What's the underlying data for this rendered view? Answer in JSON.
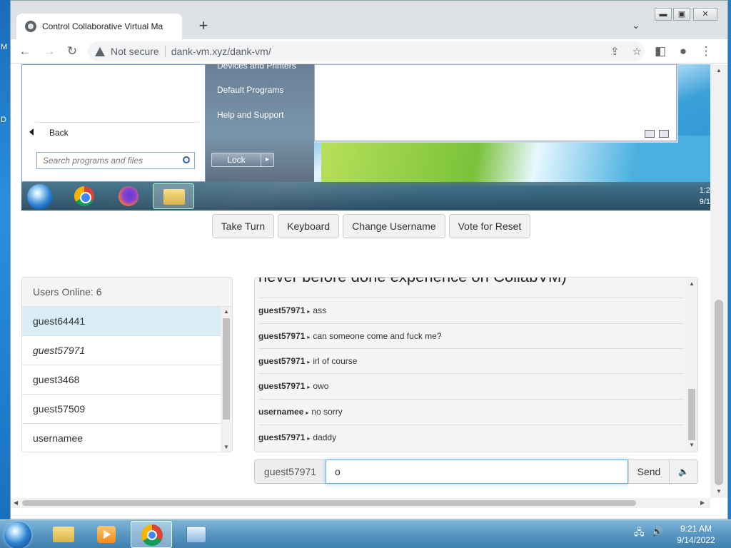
{
  "desktop": {
    "left_letters": [
      "M",
      "D"
    ]
  },
  "browser": {
    "tab_title": "Control Collaborative Virtual Ma",
    "new_tab": "+",
    "omnibox": {
      "security": "Not secure",
      "url": "dank-vm.xyz/dank-vm/"
    }
  },
  "vm": {
    "start_menu": {
      "partial_item": "Devices and Printers",
      "links": [
        "Default Programs",
        "Help and Support"
      ],
      "back": "Back",
      "search_placeholder": "Search programs and files",
      "lock": "Lock"
    },
    "clock": {
      "time": "1:2",
      "date": "9/1"
    }
  },
  "controls": {
    "take_turn": "Take Turn",
    "keyboard": "Keyboard",
    "change_username": "Change Username",
    "vote_reset": "Vote for Reset"
  },
  "users": {
    "header": "Users Online: 6",
    "list": [
      "guest64441",
      "guest57971",
      "guest3468",
      "guest57509",
      "usernamee"
    ]
  },
  "chat": {
    "partial_message": "never before done experience on CollabVM)",
    "messages": [
      {
        "user": "guest57971",
        "text": "ass"
      },
      {
        "user": "guest57971",
        "text": "can someone come and fuck me?"
      },
      {
        "user": "guest57971",
        "text": "irl of course"
      },
      {
        "user": "guest57971",
        "text": "owo"
      },
      {
        "user": "usernamee",
        "text": "no sorry"
      },
      {
        "user": "guest57971",
        "text": "daddy"
      }
    ]
  },
  "input": {
    "username": "guest57971",
    "value": "o",
    "send": "Send"
  },
  "taskbar": {
    "time": "9:21 AM",
    "date": "9/14/2022"
  }
}
